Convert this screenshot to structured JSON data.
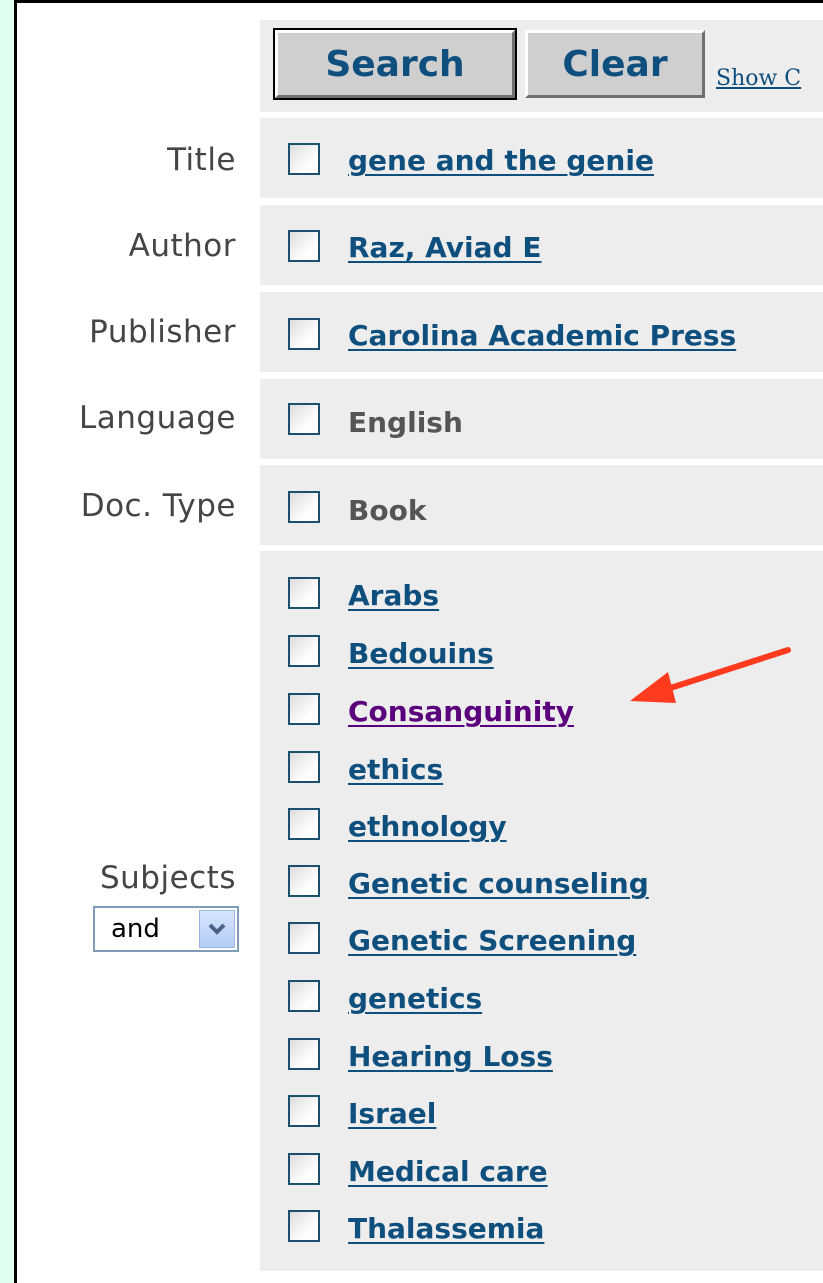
{
  "buttons": {
    "search": "Search",
    "clear": "Clear",
    "show_link": "Show C"
  },
  "fields": {
    "title": {
      "label": "Title",
      "value": "gene and the genie"
    },
    "author": {
      "label": "Author",
      "value": "Raz, Aviad E"
    },
    "publisher": {
      "label": "Publisher",
      "value": "Carolina Academic Press"
    },
    "language": {
      "label": "Language",
      "value": "English"
    },
    "doctype": {
      "label": "Doc. Type",
      "value": "Book"
    }
  },
  "subjects": {
    "label": "Subjects",
    "operator": "and",
    "items": [
      "Arabs",
      "Bedouins",
      "Consanguinity",
      "ethics",
      "ethnology",
      "Genetic counseling",
      "Genetic Screening",
      "genetics",
      "Hearing Loss",
      "Israel",
      "Medical care",
      "Thalassemia"
    ]
  },
  "colors": {
    "link": "#0f4f7e",
    "visited_link": "#5a007c",
    "annotation_arrow": "#ff3b1f",
    "page_background": "#dffff0"
  }
}
